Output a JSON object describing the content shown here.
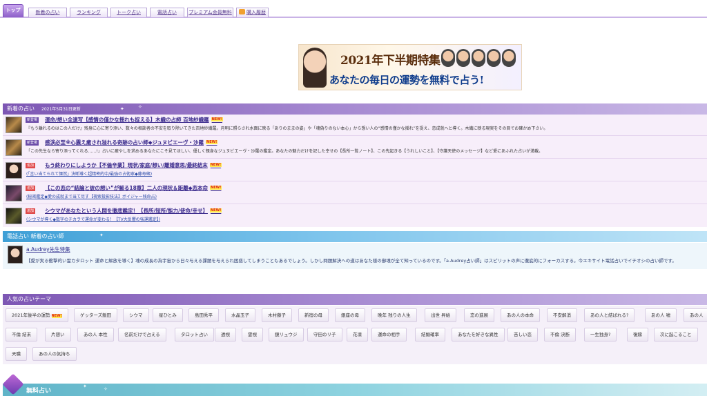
{
  "nav": {
    "tabs": [
      {
        "label": "トップ",
        "active": true
      },
      {
        "label": "新着の占い"
      },
      {
        "label": "ランキング"
      },
      {
        "label": "トーク占い"
      },
      {
        "label": "電話占い"
      },
      {
        "label": "プレミアム会員無料"
      },
      {
        "label": "購入履歴"
      }
    ]
  },
  "banner": {
    "title": "2021年下半期特集",
    "subtitle": "あなたの毎日の運勢を無料で占う!"
  },
  "new_section": {
    "title": "新着の占い",
    "date": "2021年5月31日更新",
    "items": [
      {
        "badge": "新登場",
        "title": "運命/想い全速写【感情の僅かな揺れも捉える】木織の占師 百地紗織羅",
        "new": "NEW!",
        "desc": "『もう離れるのはこの人だけ』残身に心に寄り添い、数々の相談者の不安を取り除いてきた百地紗織羅。月明に照らされ水面に映る「ありのままの姿」や「魂偽りのない本心」から想い人の“感情の僅かな揺れ”を捉え、恋成就へと導く。木織に映る現実をその目でお確かめ下さい。"
      },
      {
        "badge": "新登場",
        "title": "感涙必至※心震え癒され溢れる奇跡の占い師◆ジュヌビエーヴ・沙羅",
        "new": "NEW!",
        "desc": "「この先生なら寄り添ってくれる……!」占いに癒やしを求めるあなたにこそ見てほしい、優しく親身なジュヌビエーヴ・沙羅の鑑定。あなたの魅力だけを記した幸せの【長所一覧ノート】、この先起きる【うれしいこと】、【守護天使のメッセージ】など愛にあふれた占いが満載。"
      },
      {
        "badge": "追加",
        "title": "もう終わりにしようか【不倫辛業】現状/家庭/想い/離婚意思/最終結末",
        "new": "NEW!",
        "desc": "(「言い当てられて慄然」決断導く超精密的中/最強の占術家◆藤寿緒)"
      },
      {
        "badge": "追加",
        "title": "【この恋の“結論と彼の想い”が解る18章】二人の現状＆距離◆恋本命",
        "new": "NEW!",
        "desc": "(秘密鑑定◆愛の成就まで当て尽す【視索投影技法】ボイジャー残命占)"
      },
      {
        "badge": "追加",
        "title": "シウマがあなたという人間を徹底鑑定！【長所/短所/能力/使命/幸せ】",
        "new": "NEW!",
        "desc": "(シウマが導く◆数字のチカラで運命が変わる！【TV大反響の強運鑑定】)"
      }
    ]
  },
  "tel_section": {
    "title": "電話占い 新着の占い師",
    "name": "a.Audrey先生特集",
    "desc": "【愛が実る衝撃的い霊カタロット 運命と解放を導く】魂の成長の為宇宙から日々与える課題を与えられ困惑してしまうこともあるでしょう。しかし問題解決への道はあなた様の御魂が全て知っているのです。「a.Audrey占い師」はスピリットの声に徹底的にフォーカスする。今エキサイト電話占いでイチオシの占い師です。"
  },
  "themes_section": {
    "title": "人気の占いテーマ",
    "row1": [
      "2021年後半の運勢",
      "ゲッターズ飯田",
      "シウマ",
      "星ひとみ",
      "島田秀平",
      "水晶玉子",
      "木村藤子",
      "新宿の母",
      "銀座の母",
      "晩年 残りの人生",
      "出世 昇給",
      "恋の進展",
      "あの人の本命",
      "不安解消",
      "あの人と結ばれる?",
      "あの人 嘘",
      "あの人"
    ],
    "row1_new": "NEW!",
    "row2": [
      "不倫 結末",
      "片想い",
      "あの人 本性",
      "名前だけで占える",
      "タロット占い",
      "透視",
      "霊視",
      "鏡リュウジ",
      "守田のリ子",
      "花凛",
      "運命の相手",
      "結婚確率",
      "あなたを好きな異性",
      "苦しい恋",
      "不倫 決断",
      "一生独身?",
      "復縁",
      "次に起こること"
    ],
    "row3": [
      "天職",
      "あの人の気持ち"
    ]
  },
  "free_section": {
    "title": "無料占い"
  }
}
